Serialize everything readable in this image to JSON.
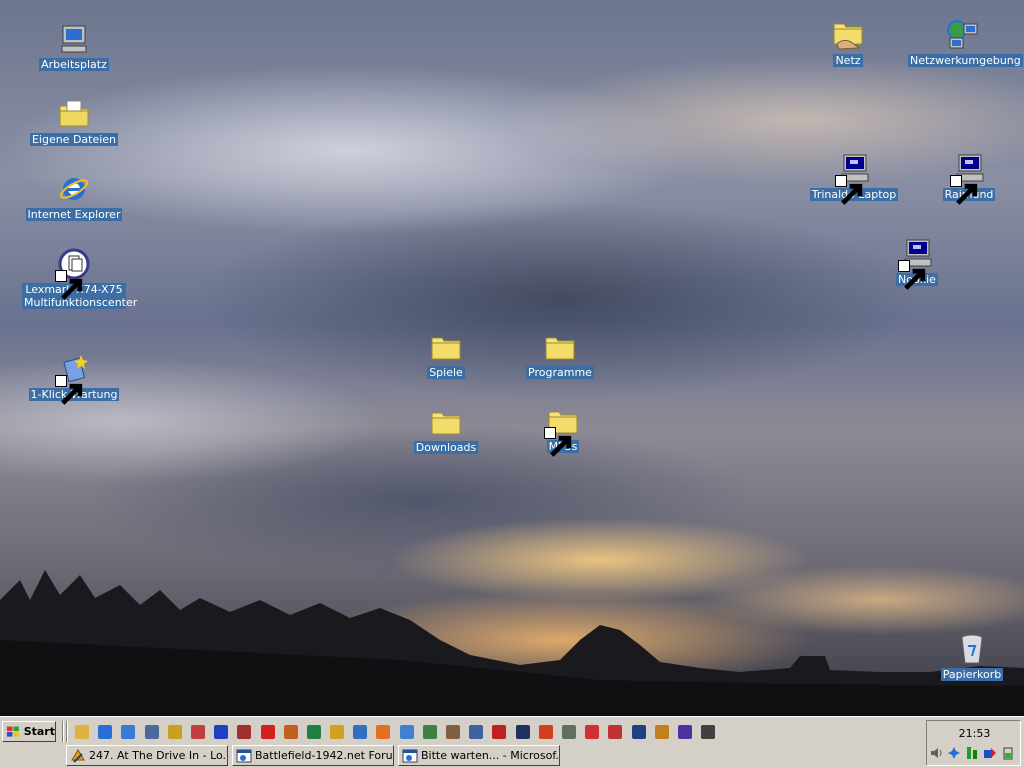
{
  "desktop": {
    "icons": [
      {
        "label": "Arbeitsplatz",
        "icon": "my-computer-icon"
      },
      {
        "label": "Eigene Dateien",
        "icon": "my-documents-icon"
      },
      {
        "label": "Internet Explorer",
        "icon": "internet-explorer-icon"
      },
      {
        "label": "Lexmark X74-X75 Multifunktionscenter",
        "icon": "lexmark-icon",
        "shortcut": true
      },
      {
        "label": "1-Klick-Wartung",
        "icon": "maintenance-icon",
        "shortcut": true
      },
      {
        "label": "Spiele",
        "icon": "folder-icon"
      },
      {
        "label": "Programme",
        "icon": "folder-icon"
      },
      {
        "label": "Downloads",
        "icon": "folder-icon"
      },
      {
        "label": "MP3s",
        "icon": "folder-icon",
        "shortcut": true
      },
      {
        "label": "Netz",
        "icon": "shared-folder-icon"
      },
      {
        "label": "Netzwerkumgebung",
        "icon": "network-neighborhood-icon"
      },
      {
        "label": "Trinaldo Laptop",
        "icon": "network-computer-icon",
        "shortcut": true
      },
      {
        "label": "Raimund",
        "icon": "network-computer-icon",
        "shortcut": true
      },
      {
        "label": "Nookie",
        "icon": "network-computer-icon",
        "shortcut": true
      },
      {
        "label": "Papierkorb",
        "icon": "recycle-bin-icon"
      }
    ]
  },
  "taskbar": {
    "start_label": "Start",
    "quick_launch": [
      {
        "icon": "show-desktop-icon",
        "color": "#e0b040"
      },
      {
        "icon": "internet-explorer-icon",
        "color": "#2a6fd6"
      },
      {
        "icon": "outlook-express-icon",
        "color": "#3a7bd5"
      },
      {
        "icon": "tool-icon",
        "color": "#4a6a9a"
      },
      {
        "icon": "winamp-icon",
        "color": "#c8a020"
      },
      {
        "icon": "player-icon",
        "color": "#c04040"
      },
      {
        "icon": "app-icon",
        "color": "#2040c0"
      },
      {
        "icon": "disk-icon",
        "color": "#a03030"
      },
      {
        "icon": "flash-icon",
        "color": "#d02020"
      },
      {
        "icon": "java-icon",
        "color": "#c06020"
      },
      {
        "icon": "image-icon",
        "color": "#208040"
      },
      {
        "icon": "key-icon",
        "color": "#d0a020"
      },
      {
        "icon": "search-icon",
        "color": "#3070c0"
      },
      {
        "icon": "cone-icon",
        "color": "#e07020"
      },
      {
        "icon": "drop-icon",
        "color": "#4080d0"
      },
      {
        "icon": "triangle-icon",
        "color": "#408040"
      },
      {
        "icon": "gear-icon",
        "color": "#806040"
      },
      {
        "icon": "monitor-icon",
        "color": "#4060a0"
      },
      {
        "icon": "bug-icon",
        "color": "#c02020"
      },
      {
        "icon": "envelope-icon",
        "color": "#203060"
      },
      {
        "icon": "globe-icon",
        "color": "#d04020"
      },
      {
        "icon": "settings-icon",
        "color": "#607060"
      },
      {
        "icon": "stop-icon",
        "color": "#d03030"
      },
      {
        "icon": "puzzle-icon",
        "color": "#c03030"
      },
      {
        "icon": "compass-icon",
        "color": "#204080"
      },
      {
        "icon": "star-icon",
        "color": "#c08020"
      },
      {
        "icon": "orb-icon",
        "color": "#5030a0"
      },
      {
        "icon": "window-icon",
        "color": "#404040"
      }
    ],
    "tasks": [
      {
        "label": "247. At The Drive In - Lo...",
        "icon": "winamp-icon"
      },
      {
        "label": "Battlefield-1942.net Foru...",
        "icon": "internet-explorer-icon"
      },
      {
        "label": "Bitte warten... - Microsof...",
        "icon": "internet-explorer-icon"
      }
    ],
    "clock": "21:53"
  },
  "colors": {
    "label_bg": "#3a6ea5",
    "taskbar_bg": "#d4d0c8",
    "folder": "#f5e27a"
  }
}
